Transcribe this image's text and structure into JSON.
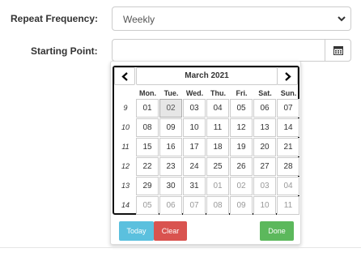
{
  "form": {
    "repeat_label": "Repeat Frequency:",
    "repeat_value": "Weekly",
    "start_label": "Starting Point:",
    "start_value": ""
  },
  "calendar": {
    "month_label": "March 2021",
    "weekdays": [
      "Mon.",
      "Tue.",
      "Wed.",
      "Thu.",
      "Fri.",
      "Sat.",
      "Sun."
    ],
    "weeks": [
      {
        "num": "9",
        "days": [
          "01",
          "02",
          "03",
          "04",
          "05",
          "06",
          "07"
        ]
      },
      {
        "num": "10",
        "days": [
          "08",
          "09",
          "10",
          "11",
          "12",
          "13",
          "14"
        ]
      },
      {
        "num": "11",
        "days": [
          "15",
          "16",
          "17",
          "18",
          "19",
          "20",
          "21"
        ]
      },
      {
        "num": "12",
        "days": [
          "22",
          "23",
          "24",
          "25",
          "26",
          "27",
          "28"
        ]
      },
      {
        "num": "13",
        "days": [
          "29",
          "30",
          "31",
          "01",
          "02",
          "03",
          "04"
        ]
      },
      {
        "num": "14",
        "days": [
          "05",
          "06",
          "07",
          "08",
          "09",
          "10",
          "11"
        ]
      }
    ],
    "today_label": "Today",
    "clear_label": "Clear",
    "done_label": "Done"
  },
  "icons": {
    "select_chevron": "chevron-down-icon",
    "calendar_button": "calendar-icon",
    "prev": "chevron-left-icon",
    "next": "chevron-right-icon"
  },
  "colors": {
    "today_button": "#5bc0de",
    "clear_button": "#d9534f",
    "done_button": "#5cb85c",
    "current_day": "#e6e6e6"
  }
}
